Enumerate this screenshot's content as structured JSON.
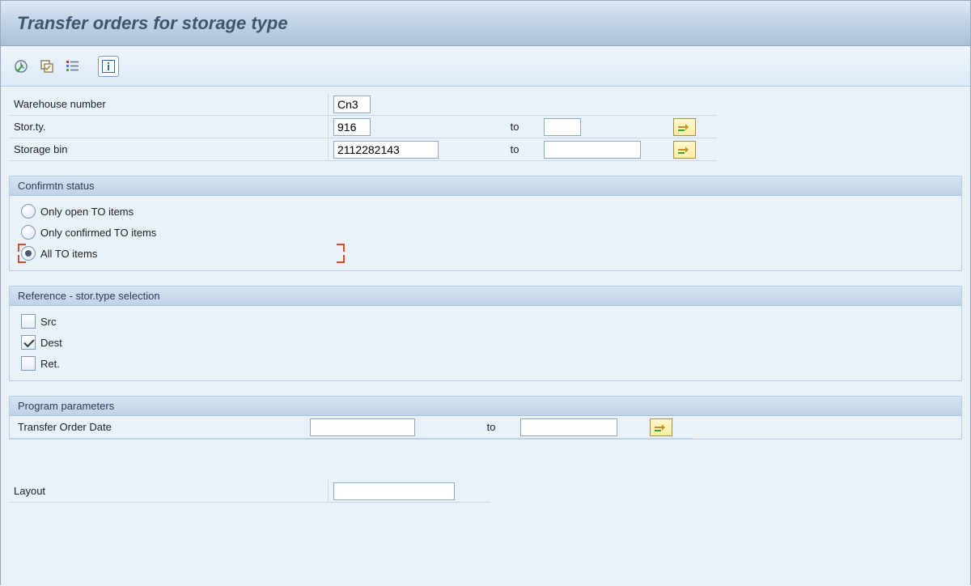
{
  "title": "Transfer orders for storage type",
  "form": {
    "warehouse": {
      "label": "Warehouse number",
      "value": "Cn3"
    },
    "storType": {
      "label": "Stor.ty.",
      "value": "916",
      "to_label": "to",
      "to_value": ""
    },
    "storageBin": {
      "label": "Storage bin",
      "value": "2112282143",
      "to_label": "to",
      "to_value": ""
    }
  },
  "confirm": {
    "title": "Confirmtn status",
    "opt1": "Only open TO items",
    "opt2": "Only confirmed TO items",
    "opt3": "All TO items"
  },
  "reference": {
    "title": "Reference - stor.type selection",
    "src": "Src",
    "dest": "Dest",
    "ret": "Ret."
  },
  "program": {
    "title": "Program parameters",
    "todate": {
      "label": "Transfer Order Date",
      "value": "",
      "to_label": "to",
      "to_value": ""
    }
  },
  "layout": {
    "label": "Layout",
    "value": ""
  }
}
